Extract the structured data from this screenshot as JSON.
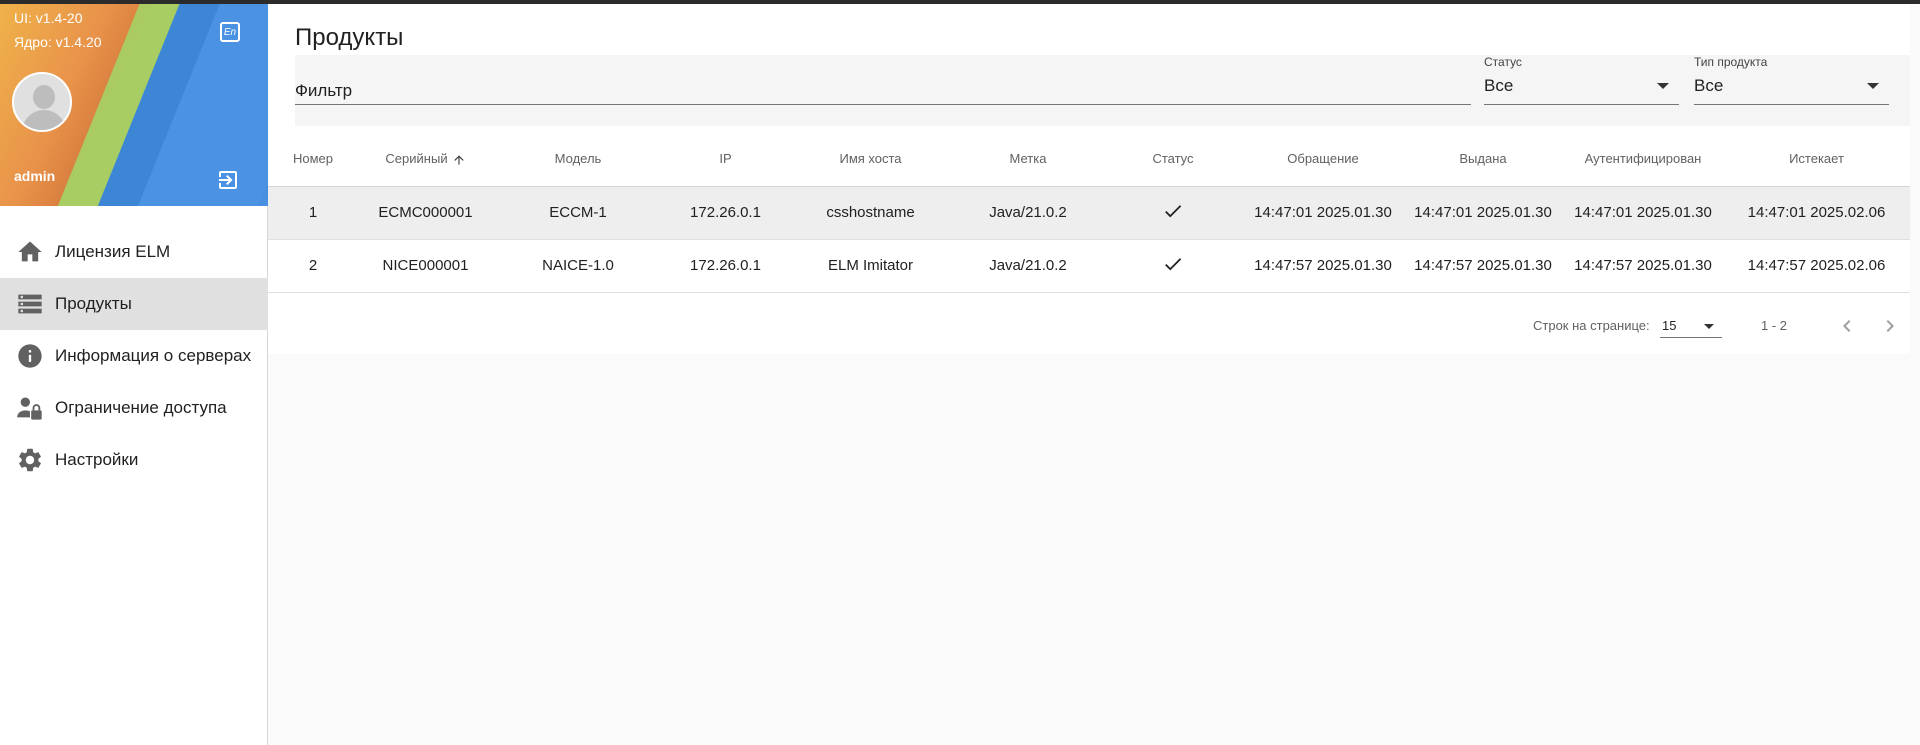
{
  "sidebar": {
    "ui_version": "UI: v1.4-20",
    "core_version": "Ядро: v1.4.20",
    "lang_button": "En",
    "username": "admin",
    "items": [
      {
        "label": "Лицензия ELM",
        "icon": "home-icon",
        "active": false
      },
      {
        "label": "Продукты",
        "icon": "list-icon",
        "active": true
      },
      {
        "label": "Информация о серверах",
        "icon": "info-icon",
        "active": false
      },
      {
        "label": "Ограничение доступа",
        "icon": "lock-person-icon",
        "active": false
      },
      {
        "label": "Настройки",
        "icon": "gear-icon",
        "active": false
      }
    ]
  },
  "main": {
    "title": "Продукты",
    "filter": {
      "placeholder": "Фильтр"
    },
    "status_select": {
      "caption": "Статус",
      "value": "Все"
    },
    "type_select": {
      "caption": "Тип продукта",
      "value": "Все"
    }
  },
  "table": {
    "headers": [
      "Номер",
      "Серийный",
      "Модель",
      "IP",
      "Имя хоста",
      "Метка",
      "Статус",
      "Обращение",
      "Выдана",
      "Аутентифицирован",
      "Истекает"
    ],
    "rows": [
      [
        "1",
        "ECMC000001",
        "ECCM-1",
        "172.26.0.1",
        "csshostname",
        "Java/21.0.2",
        "✓",
        "14:47:01 2025.01.30",
        "14:47:01 2025.01.30",
        "14:47:01 2025.01.30",
        "14:47:01 2025.02.06"
      ],
      [
        "2",
        "NICE000001",
        "NAICE-1.0",
        "172.26.0.1",
        "ELM Imitator",
        "Java/21.0.2",
        "✓",
        "14:47:57 2025.01.30",
        "14:47:57 2025.01.30",
        "14:47:57 2025.01.30",
        "14:47:57 2025.02.06"
      ]
    ]
  },
  "pager": {
    "rows_label": "Строк на странице:",
    "rows_value": "15",
    "range": "1 - 2"
  },
  "colors": {
    "active_nav": "#e0e0e0",
    "filter_bg": "#f5f5f5"
  }
}
